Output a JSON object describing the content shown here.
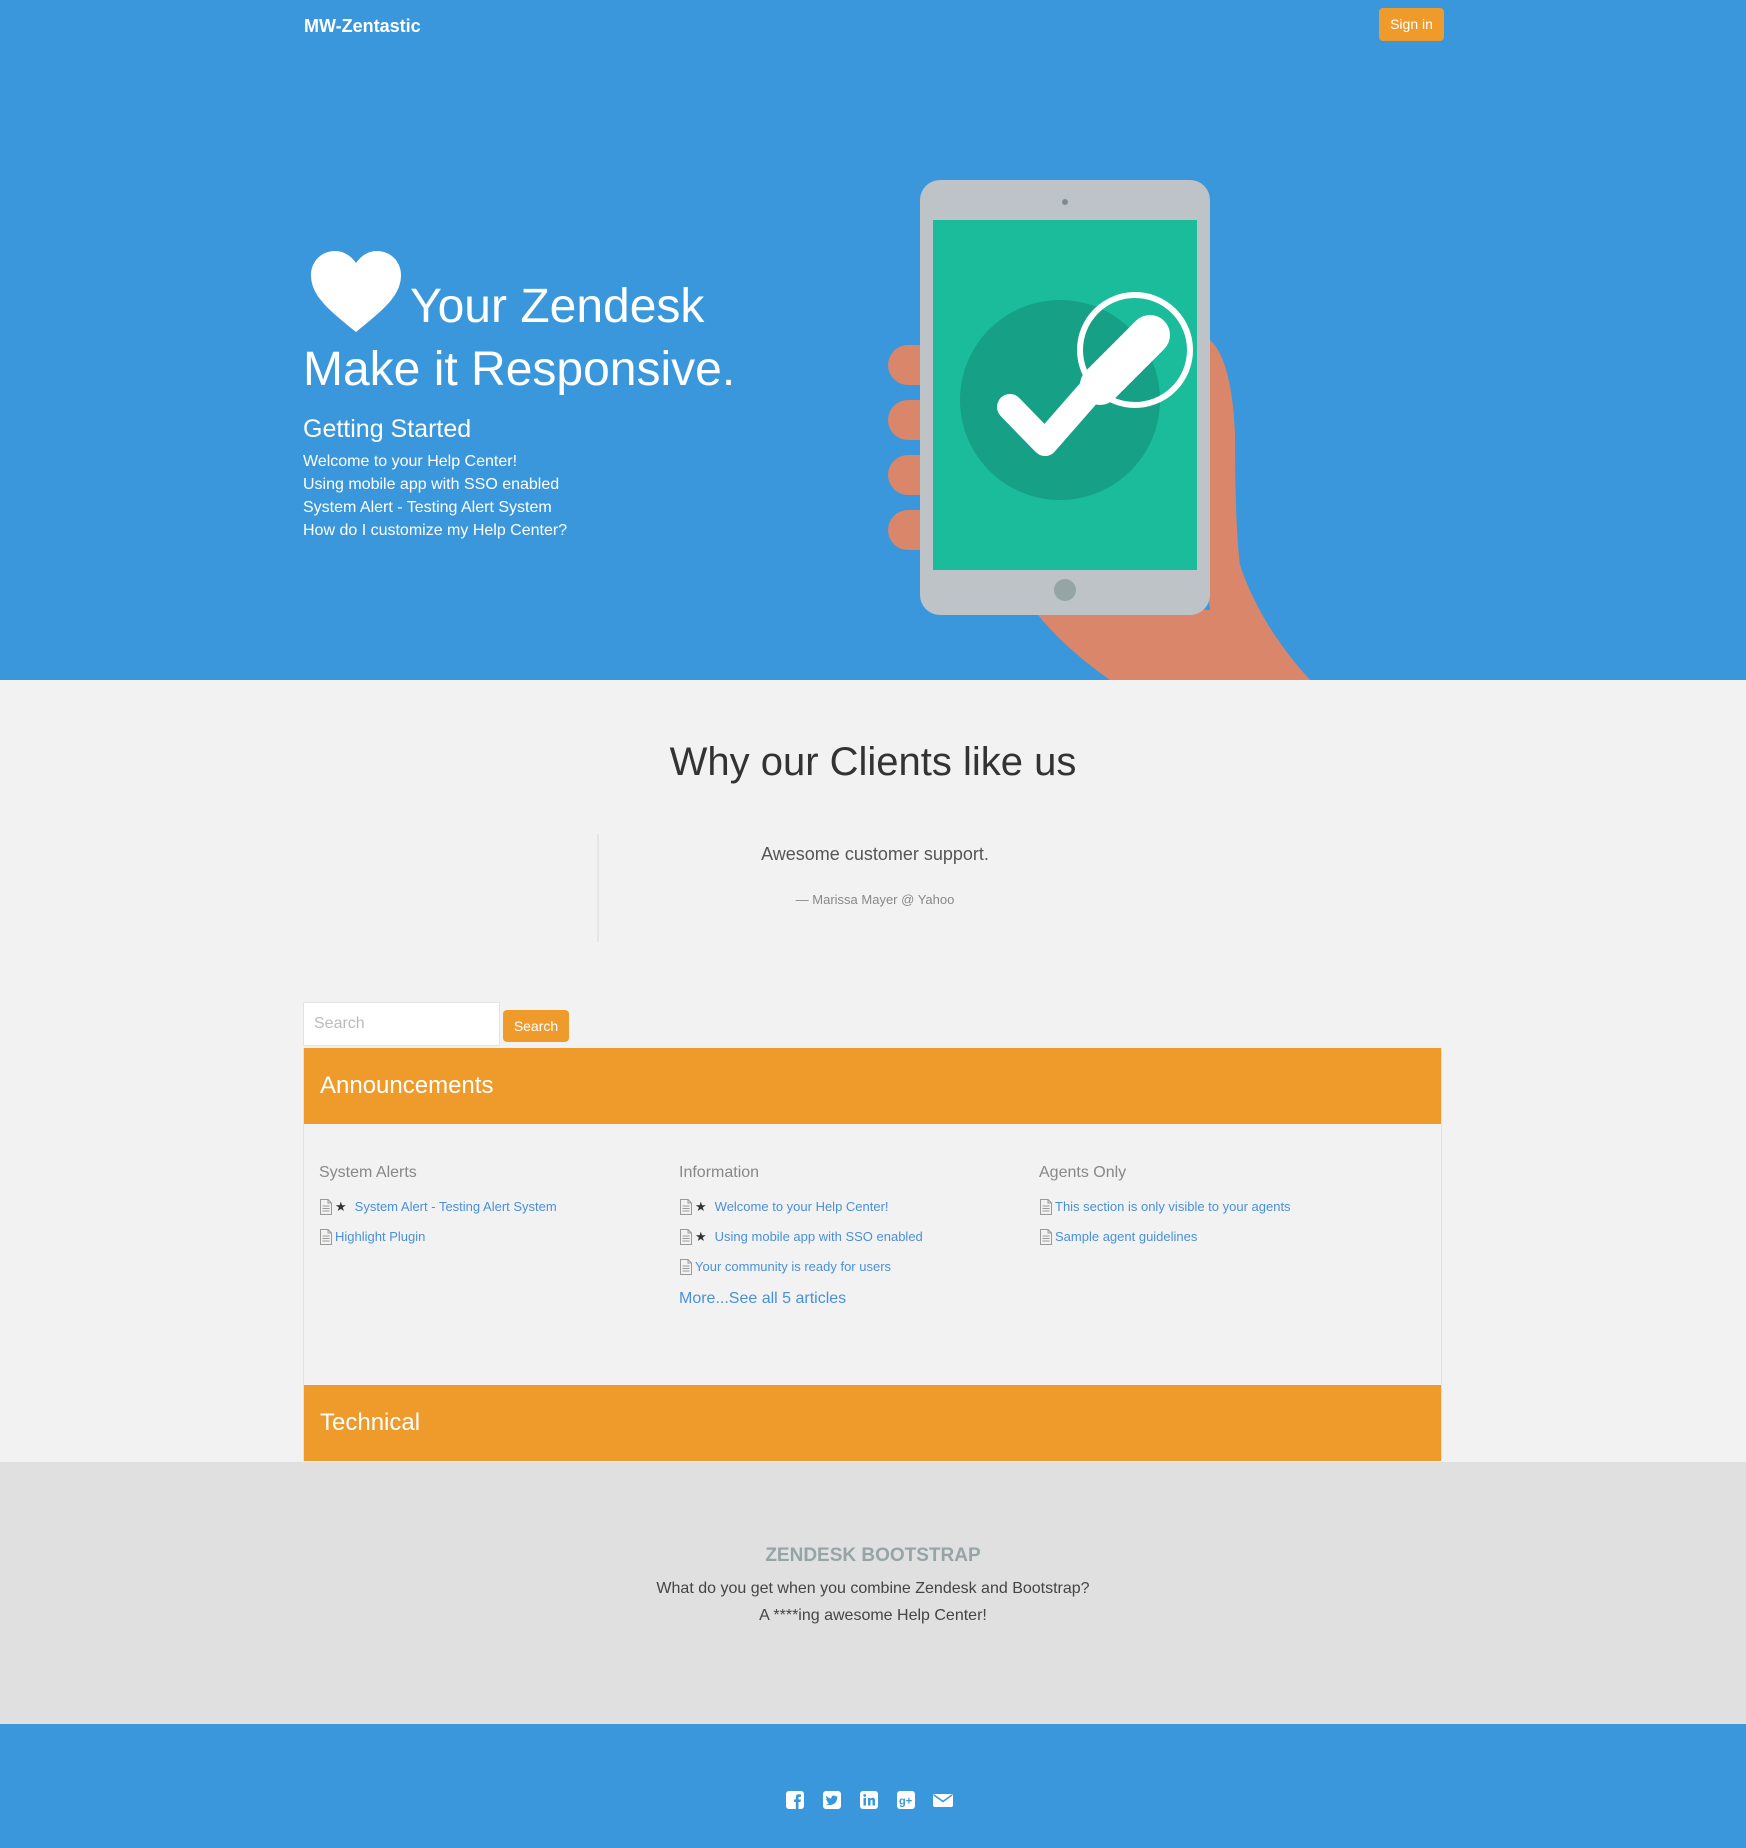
{
  "header": {
    "brand": "MW-Zentastic",
    "signin_label": "Sign in"
  },
  "hero": {
    "heart_icon": "heart-icon",
    "line1": "Your Zendesk",
    "line2": "Make it Responsive.",
    "getting_started": {
      "title": "Getting Started",
      "links": [
        "Welcome to your Help Center!",
        "Using mobile app with SSO enabled",
        "System Alert - Testing Alert System",
        "How do I customize my Help Center?"
      ]
    },
    "illustration": "hand-holding-tablet-with-checkmark"
  },
  "testimonials": {
    "title": "Why our Clients like us",
    "quote": "Awesome customer support.",
    "author": "— Marissa Mayer @ Yahoo"
  },
  "search": {
    "placeholder": "Search",
    "button_label": "Search"
  },
  "categories": [
    {
      "name": "Announcements",
      "sections": [
        {
          "title": "System Alerts",
          "articles": [
            {
              "label": "System Alert - Testing Alert System",
              "promoted": true
            },
            {
              "label": "Highlight Plugin",
              "promoted": false
            }
          ]
        },
        {
          "title": "Information",
          "articles": [
            {
              "label": "Welcome to your Help Center!",
              "promoted": true
            },
            {
              "label": "Using mobile app with SSO enabled",
              "promoted": true
            },
            {
              "label": "Your community is ready for users",
              "promoted": false
            }
          ],
          "more_label": "More...See all 5 articles"
        },
        {
          "title": "Agents Only",
          "articles": [
            {
              "label": "This section is only visible to your agents",
              "promoted": false
            },
            {
              "label": "Sample agent guidelines",
              "promoted": false
            }
          ]
        }
      ]
    },
    {
      "name": "Technical"
    }
  ],
  "footer": {
    "title": "ZENDESK BOOTSTRAP",
    "line1": "What do you get when you combine Zendesk and Bootstrap?",
    "line2": "A ****ing awesome Help Center!",
    "social_icons": [
      "facebook-icon",
      "twitter-icon",
      "linkedin-icon",
      "google-plus-icon",
      "email-icon"
    ]
  },
  "colors": {
    "primary_blue": "#3a97dc",
    "accent_orange": "#ee9b2c",
    "link_blue": "#4a90d9",
    "page_bg": "#f2f2f2",
    "footer_grey": "#e0e0e0",
    "title_teal_grey": "#95a5a6"
  }
}
